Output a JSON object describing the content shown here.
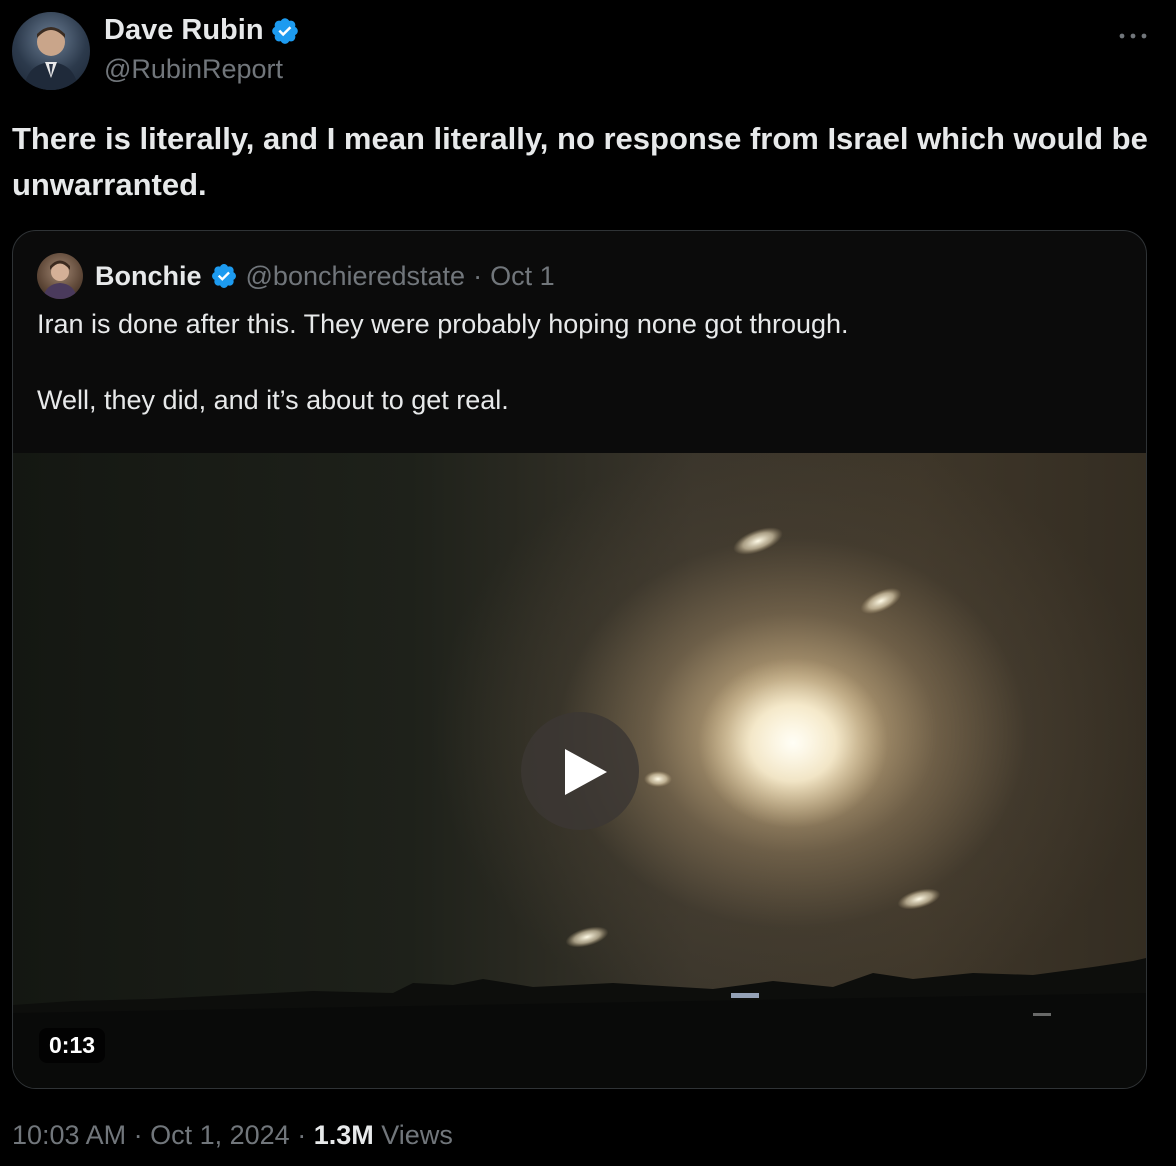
{
  "author": {
    "display_name": "Dave Rubin",
    "handle": "@RubinReport",
    "verified": true
  },
  "more_icon": "more-horizontal-icon",
  "tweet": {
    "text": "There is literally, and I mean literally, no response from Israel which would be unwarranted."
  },
  "quoted": {
    "display_name": "Bonchie",
    "handle": "@bonchieredstate",
    "separator": "·",
    "date": "Oct 1",
    "line1": "Iran is done after this. They were probably hoping none got through.",
    "line2": "Well, they did, and it’s about to get real.",
    "video": {
      "duration": "0:13",
      "play_icon": "play-icon"
    }
  },
  "meta": {
    "time": "10:03 AM",
    "sep1": "·",
    "date": "Oct 1, 2024",
    "sep2": "·",
    "views_count": "1.3M",
    "views_label": "Views"
  },
  "colors": {
    "background": "#000000",
    "text": "#e7e9ea",
    "muted": "#71767b",
    "verified_blue": "#1d9bf0",
    "border": "#2f3336"
  }
}
